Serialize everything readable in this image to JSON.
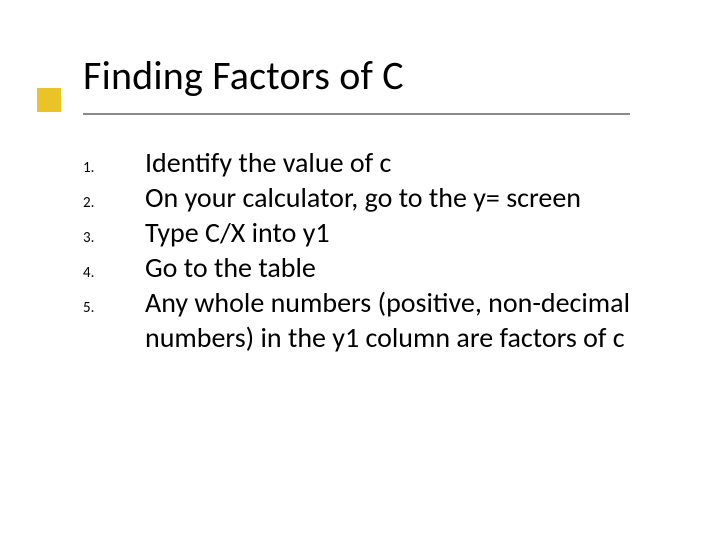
{
  "title": "Finding Factors of C",
  "steps": {
    "s1": {
      "n": "1.",
      "t": "Identify the value of c"
    },
    "s2": {
      "n": "2.",
      "t": "On your calculator, go to the y= screen"
    },
    "s3": {
      "n": "3.",
      "t": "Type C/X into y1"
    },
    "s4": {
      "n": "4.",
      "t": "Go to the table"
    },
    "s5": {
      "n": "5.",
      "t": "Any whole numbers (positive, non-decimal numbers) in the y1 column are factors of c"
    }
  }
}
